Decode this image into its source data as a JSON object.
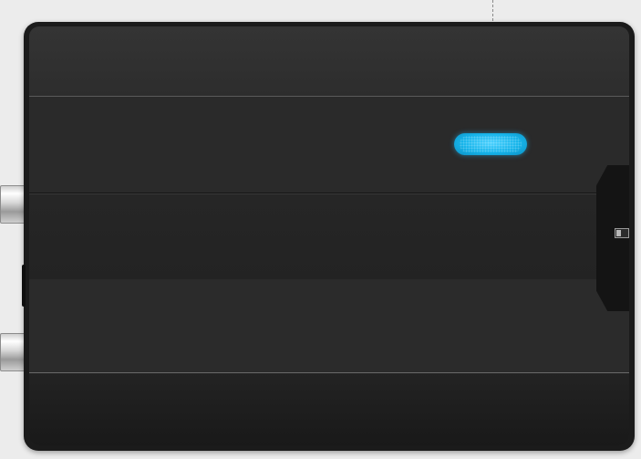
{
  "scene": {
    "background_color": "#ececec",
    "device_color": "#262626",
    "led_color": "#17b4ea",
    "connector_color": "#cfcfcf",
    "objects": [
      "device-body",
      "status-led",
      "leader-line",
      "connector-top",
      "connector-bottom",
      "side-switch"
    ]
  }
}
